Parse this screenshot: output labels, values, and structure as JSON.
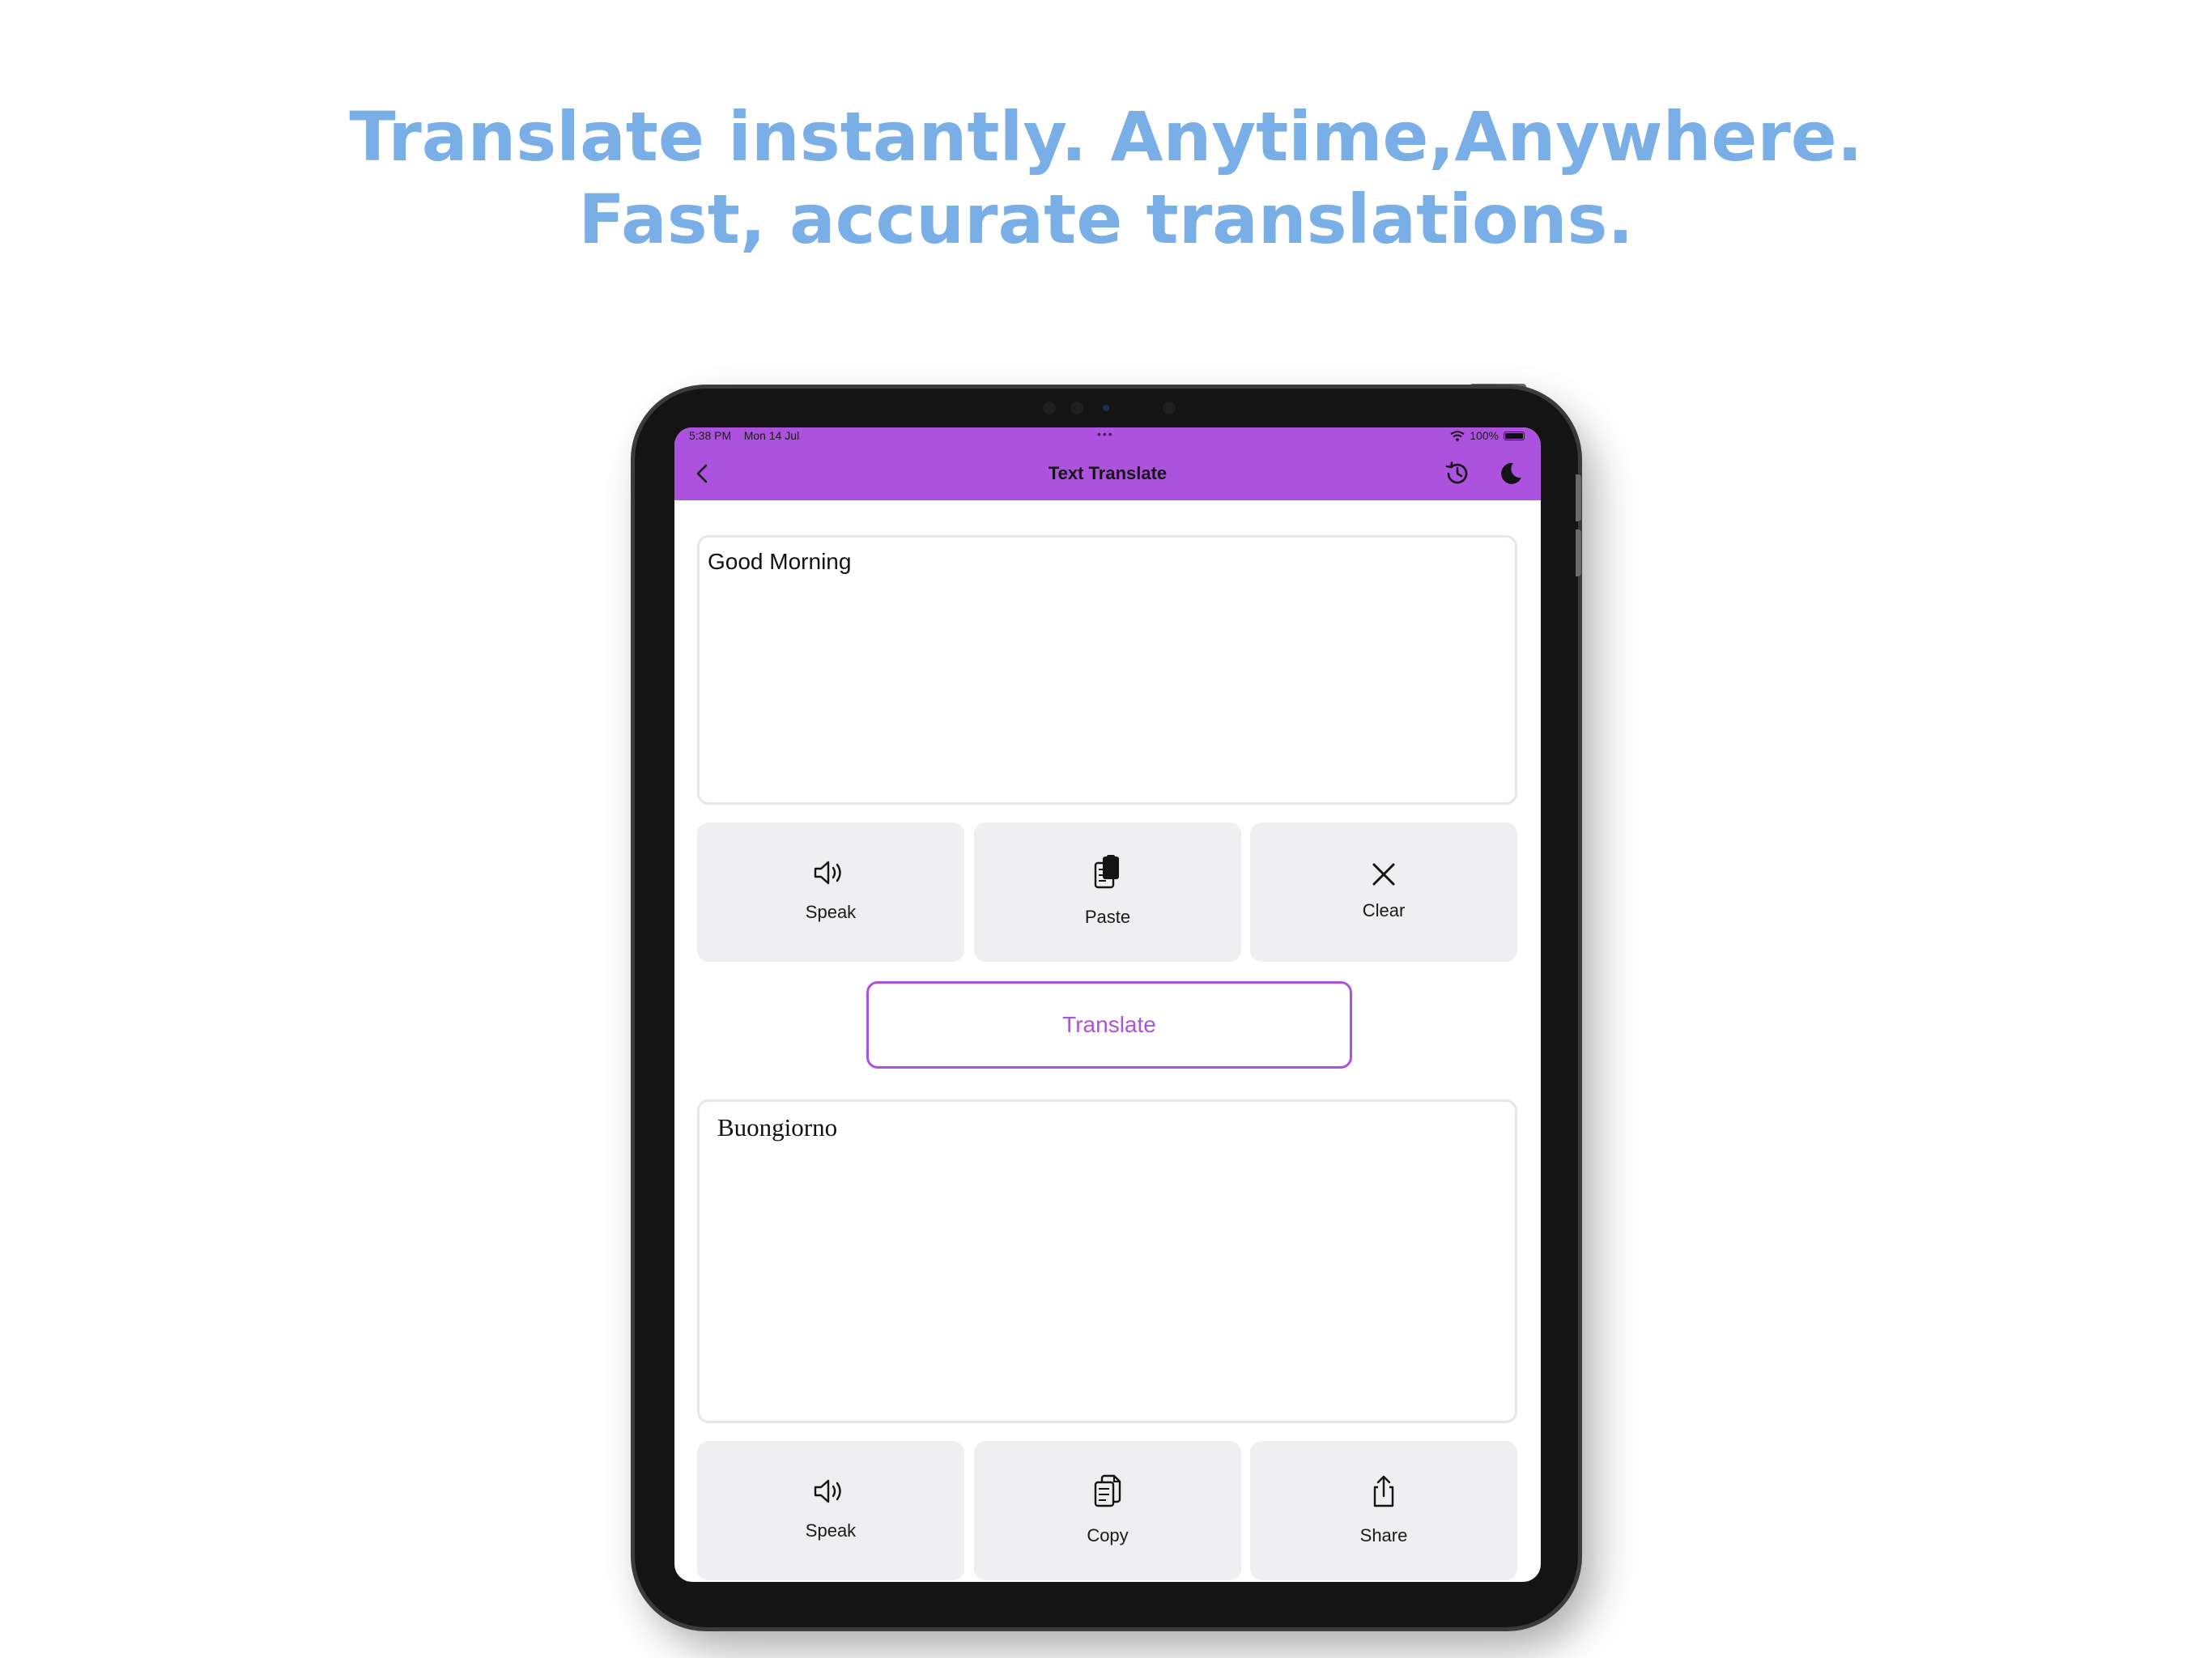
{
  "headline": {
    "line1": "Translate instantly. Anytime,Anywhere.",
    "line2": "Fast, accurate translations."
  },
  "status_bar": {
    "time": "5:38 PM",
    "date": "Mon 14 Jul",
    "dots": "•••",
    "battery_label": "100%"
  },
  "nav": {
    "title": "Text Translate",
    "back_icon": "chevron-left-icon",
    "history_icon": "history-icon",
    "theme_icon": "moon-icon"
  },
  "input": {
    "value": "Good Morning"
  },
  "input_actions": [
    {
      "label": "Speak",
      "icon": "speaker-icon"
    },
    {
      "label": "Paste",
      "icon": "paste-icon"
    },
    {
      "label": "Clear",
      "icon": "close-icon"
    }
  ],
  "translate_button": {
    "label": "Translate"
  },
  "output": {
    "value": "Buongiorno"
  },
  "output_actions": [
    {
      "label": "Speak",
      "icon": "speaker-icon"
    },
    {
      "label": "Copy",
      "icon": "copy-icon"
    },
    {
      "label": "Share",
      "icon": "share-icon"
    }
  ],
  "colors": {
    "accent": "#ad52df",
    "headline": "#7aaee6",
    "button_bg": "#efeff1"
  }
}
